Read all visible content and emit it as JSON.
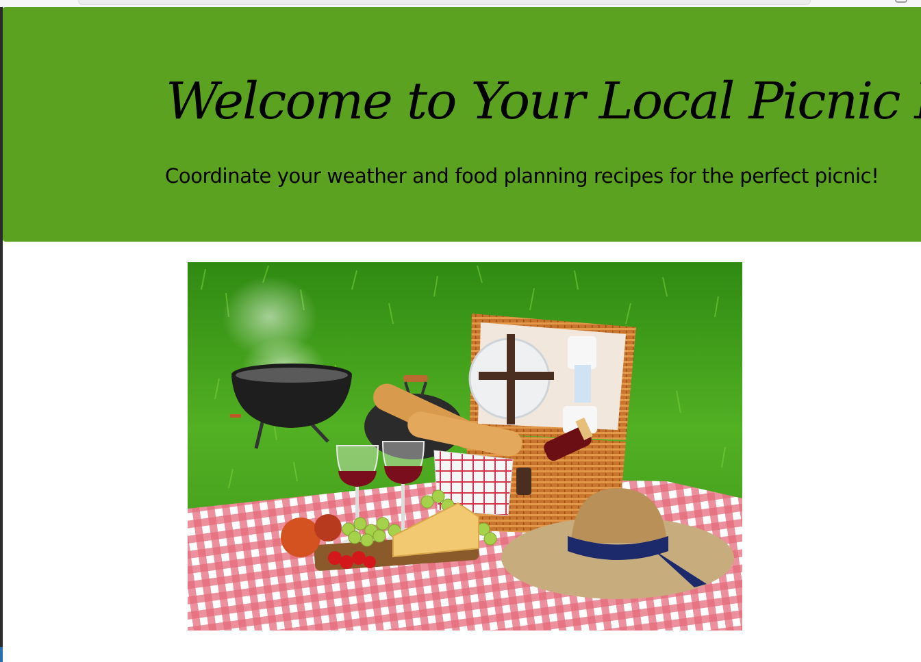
{
  "hero": {
    "title": "Welcome to Your Local Picnic Planner",
    "subtitle": "Coordinate your weather and food planning recipes for the perfect picnic!"
  },
  "colors": {
    "hero_background": "#5aa21f",
    "text": "#000000",
    "page_background": "#ffffff"
  },
  "image": {
    "subject": "picnic-scene"
  }
}
